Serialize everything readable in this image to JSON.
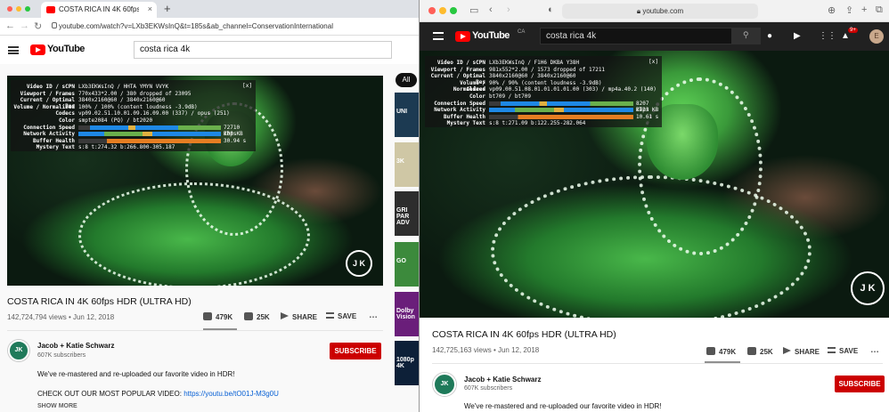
{
  "left": {
    "tab_title": "COSTA RICA IN 4K 60fps HDR (ULTRA HD)",
    "tab_close": "×",
    "new_tab": "+",
    "url": "youtube.com/watch?v=LXb3EKWsInQ&t=185s&ab_channel=ConservationInternational",
    "logo_text": "YouTube",
    "search_value": "costa rica 4k",
    "chip_all": "All",
    "stats": {
      "close": "[x]",
      "rows": [
        {
          "k": "Video ID / sCPN",
          "v": "LXb3EKWsInQ / HHTA YMYN VVYK"
        },
        {
          "k": "Viewport / Frames",
          "v": "770x433*2.00 / 380 dropped of 23095"
        },
        {
          "k": "Current / Optimal Res",
          "v": "3840x2160@60 / 3840x2160@60"
        },
        {
          "k": "Volume / Normalized",
          "v": "100% / 100% (content loudness -3.9dB)"
        },
        {
          "k": "Codecs",
          "v": "vp09.02.51.10.01.09.16.09.00 (337) / opus (251)"
        },
        {
          "k": "Color",
          "v": "smpte2084 (PQ) / bt2020"
        },
        {
          "k": "Connection Speed",
          "v": "72710 Kbps"
        },
        {
          "k": "Network Activity",
          "v": "208 KB"
        },
        {
          "k": "Buffer Health",
          "v": "30.94 s"
        },
        {
          "k": "Mystery Text",
          "v": "s:8 t:274.32 b:266.800-305.187"
        }
      ]
    },
    "watermark": "J K",
    "video_title": "COSTA RICA IN 4K 60fps HDR (ULTRA HD)",
    "views_date": "142,724,794 views • Jun 12, 2018",
    "likes": "479K",
    "dislikes": "25K",
    "share": "SHARE",
    "save": "SAVE",
    "more": "…",
    "channel": "Jacob + Katie Schwarz",
    "subscribers": "607K subscribers",
    "subscribe": "SUBSCRIBE",
    "desc1": "We've re-mastered and re-uploaded our favorite video in HDR!",
    "desc2_prefix": "CHECK OUT OUR MOST POPULAR VIDEO: ",
    "desc2_link": "https://youtu.be/tO01J-M3g0U",
    "show_more": "SHOW MORE",
    "side_labels": [
      "UNI",
      "3K",
      "GRI PAR ADV",
      "GO",
      "Dolby Vision",
      "1080p 4K"
    ]
  },
  "right": {
    "url": "youtube.com",
    "logo_text": "YouTube",
    "logo_region": "CA",
    "search_value": "costa rica 4k",
    "notif_badge": "9+",
    "avatar_letter": "E",
    "stats": {
      "close": "[x]",
      "rows": [
        {
          "k": "Video ID / sCPN",
          "v": "LXb3EKWsInQ / F1H6 DKBA Y38H"
        },
        {
          "k": "Viewport / Frames",
          "v": "981x552*2.00 / 1573 dropped of 17211"
        },
        {
          "k": "Current / Optimal Res",
          "v": "3840x2160@60 / 3840x2160@60"
        },
        {
          "k": "Volume / Normalized",
          "v": "90% / 90% (content loudness -3.9dB)"
        },
        {
          "k": "Codecs",
          "v": "vp09.00.51.08.01.01.01.01.00 (303) / mp4a.40.2 (140)"
        },
        {
          "k": "Color",
          "v": "bt709 / bt709"
        },
        {
          "k": "Connection Speed",
          "v": "8207 Kbps"
        },
        {
          "k": "Network Activity",
          "v": "2723 KB"
        },
        {
          "k": "Buffer Health",
          "v": "10.61 s"
        },
        {
          "k": "Mystery Text",
          "v": "s:8 t:271.09 b:122.255-282.064"
        }
      ]
    },
    "watermark": "J K",
    "video_title": "COSTA RICA IN 4K 60fps HDR (ULTRA HD)",
    "views_date": "142,725,163 views • Jun 12, 2018",
    "likes": "479K",
    "dislikes": "25K",
    "share": "SHARE",
    "save": "SAVE",
    "more": "…",
    "channel": "Jacob + Katie Schwarz",
    "subscribers": "607K subscribers",
    "subscribe": "SUBSCRIBE",
    "desc1": "We've re-mastered and re-uploaded our favorite video in HDR!"
  }
}
